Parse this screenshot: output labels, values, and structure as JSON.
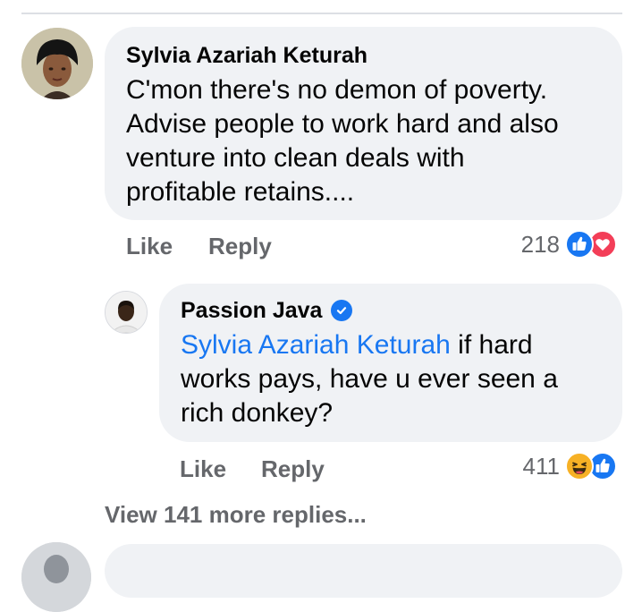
{
  "comments": [
    {
      "author": "Sylvia Azariah Keturah",
      "lines": [
        "C'mon there's no demon of poverty.",
        "Advise people to work hard and also",
        "venture into clean deals with",
        "profitable retains...."
      ],
      "like_label": "Like",
      "reply_label": "Reply",
      "reaction_count": "218",
      "reactions": [
        "like",
        "love"
      ]
    },
    {
      "author": "Passion Java",
      "verified": true,
      "mention": "Sylvia Azariah Keturah",
      "lines": [
        " if hard",
        "works pays, have u ever seen a",
        "rich donkey?"
      ],
      "like_label": "Like",
      "reply_label": "Reply",
      "reaction_count": "411",
      "reactions": [
        "haha",
        "like"
      ]
    }
  ],
  "view_more_label": "View 141 more replies...",
  "colors": {
    "bubble": "#f0f2f5",
    "meta_text": "#65676b",
    "mention": "#1877f2",
    "like_reaction": "#1877f2",
    "love_reaction": "#f33e58",
    "haha_reaction": "#f7b125"
  }
}
